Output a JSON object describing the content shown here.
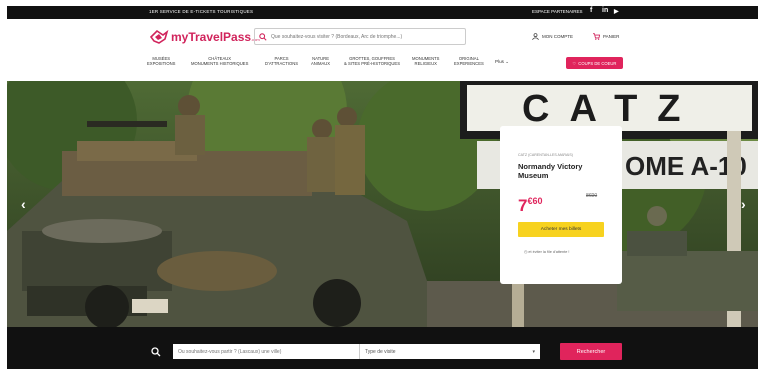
{
  "topbar": {
    "promo": "1ER SERVICE DE E-TICKETS TOURISTIQUES",
    "partner": "ESPACE PARTENAIRES",
    "social": [
      "f",
      "in",
      "▶"
    ]
  },
  "header": {
    "logo_text": "myTravelPass",
    "logo_suffix": ".com",
    "search_placeholder": "Que souhaitez-vous visiter ? (Bordeaux, Arc de triomphe...)",
    "account_label": "MON COMPTE",
    "cart_label": "PANIER"
  },
  "nav": {
    "items": [
      {
        "l1": "MUSÉES",
        "l2": "EXPOSITIONS"
      },
      {
        "l1": "CHÂTEAUX",
        "l2": "MONUMENTS HISTORIQUES"
      },
      {
        "l1": "PARCS",
        "l2": "D'ATTRACTIONS"
      },
      {
        "l1": "NATURE",
        "l2": "ANIMAUX"
      },
      {
        "l1": "GROTTES, GOUFFRES",
        "l2": "& SITES PRÉ-HISTORIQUES"
      },
      {
        "l1": "MONUMENTS",
        "l2": "RELIGIEUX"
      },
      {
        "l1": "ORIGINAL",
        "l2": "EXPERIENCES"
      }
    ],
    "more_label": "Plus",
    "coups_label": "COUPS DE COEUR"
  },
  "hero": {
    "sign_text": "CATZ",
    "sign2_text": "OME A-10",
    "card": {
      "location": "CATZ (CARENTAN-LES-MARAIS)",
      "title": "Normandy Victory Museum",
      "price_main": "7",
      "price_cents": "€60",
      "old_price": "8€00",
      "buy_label": "Acheter mes billets",
      "queue_text": "et éviter la file d'attente !"
    }
  },
  "bottom": {
    "where_placeholder": "Ou souhaitez-vous partir ? (Lascaux) une ville)",
    "type_label": "Type de visite",
    "submit_label": "Rechercher"
  },
  "colors": {
    "brand": "#e0245c",
    "buy": "#f7d21f",
    "dark": "#111111"
  }
}
